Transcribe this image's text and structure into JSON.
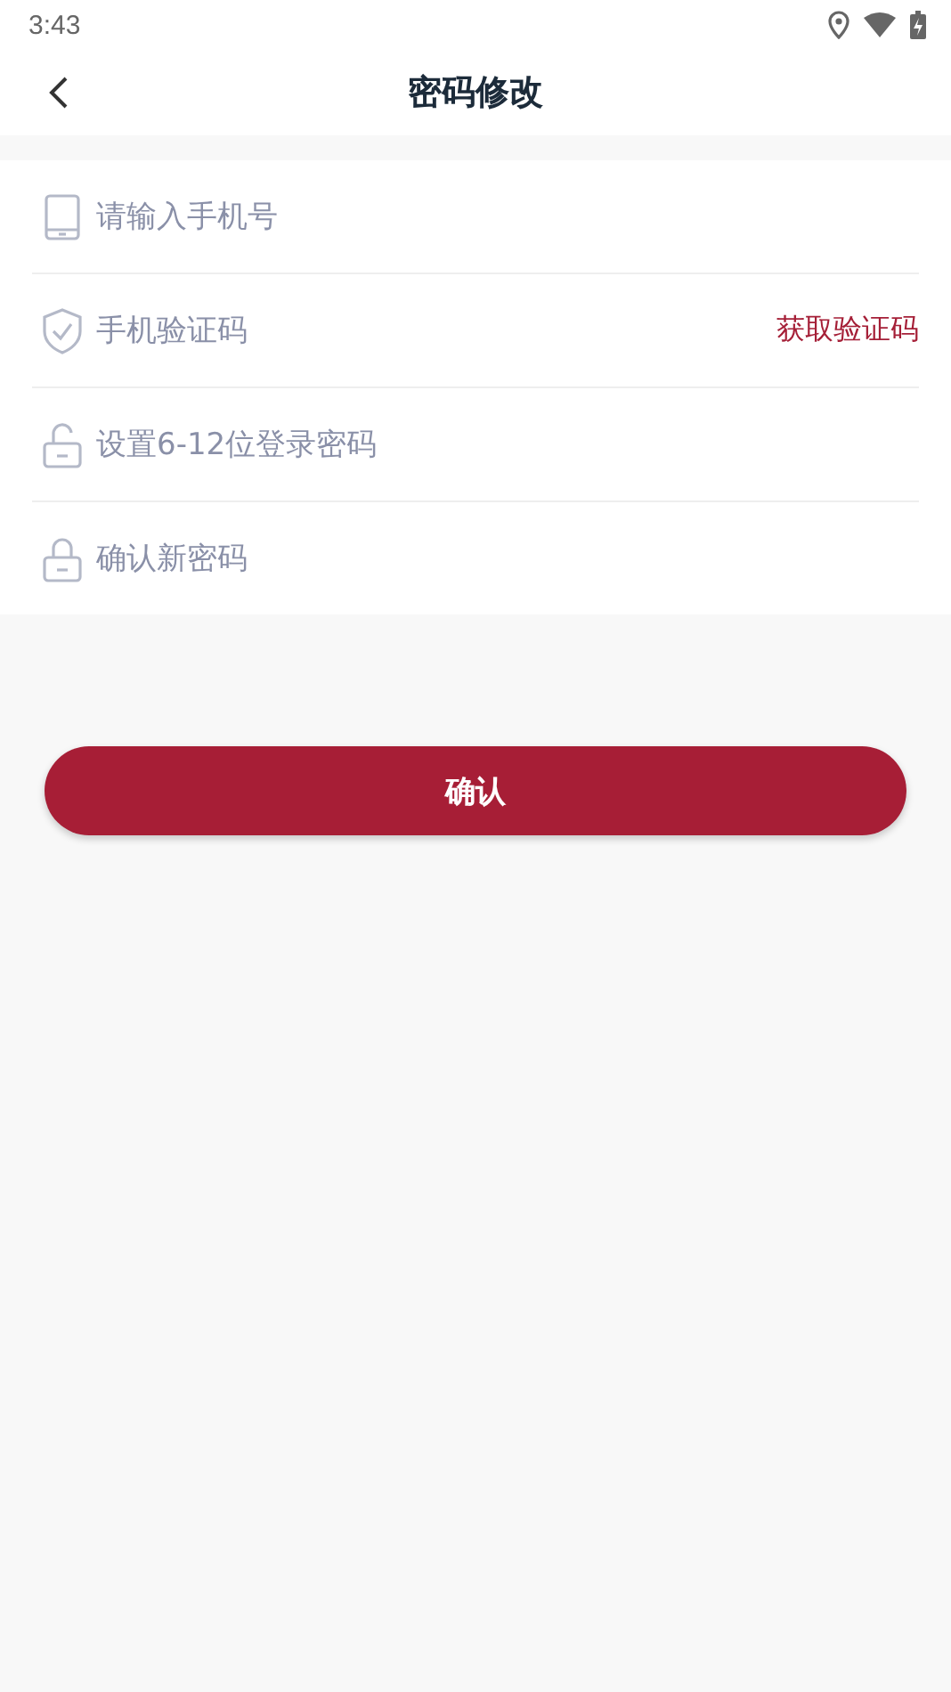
{
  "status_bar": {
    "time": "3:43"
  },
  "header": {
    "title": "密码修改"
  },
  "fields": [
    {
      "kind": "phone",
      "placeholder": "请输入手机号"
    },
    {
      "kind": "code",
      "placeholder": "手机验证码",
      "action": "获取验证码"
    },
    {
      "kind": "lock-open",
      "placeholder": "设置6-12位登录密码"
    },
    {
      "kind": "lock",
      "placeholder": "确认新密码"
    }
  ],
  "submit": {
    "label": "确认"
  }
}
